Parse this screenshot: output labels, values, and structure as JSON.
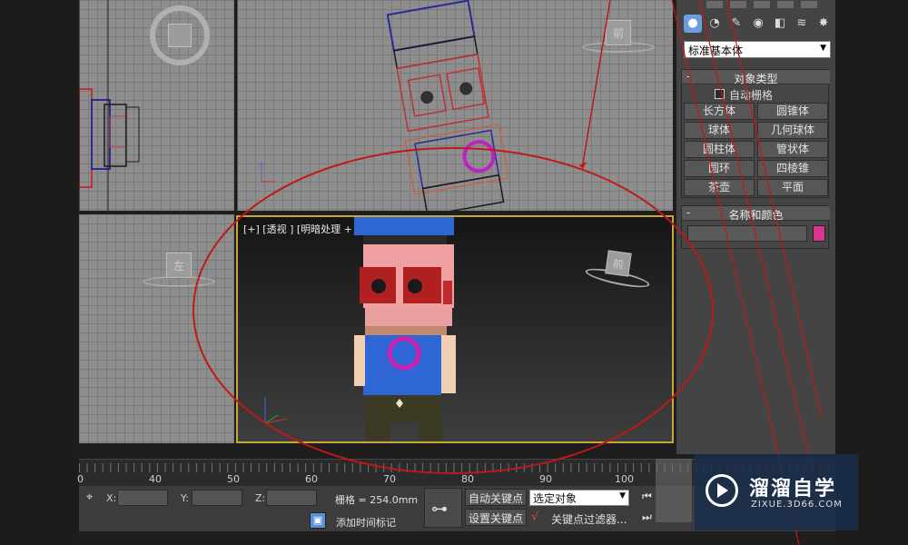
{
  "viewports": {
    "perspective_label": "[+] [透视 ] [明暗处理 + 边面 ]",
    "cube_top_right": "前",
    "cube_left": "左",
    "cube_persp": "前"
  },
  "timeline": {
    "ticks": [
      "0",
      "40",
      "50",
      "60",
      "70",
      "80",
      "90",
      "100"
    ]
  },
  "status_bar": {
    "x_label": "X:",
    "y_label": "Y:",
    "z_label": "Z:",
    "grid_text": "栅格 = 254.0mm",
    "add_time_tag": "添加时间标记",
    "auto_key": "自动关键点",
    "set_key": "设置关键点",
    "selection_value": "选定对象",
    "key_filters": "关键点过滤器..."
  },
  "command_panel": {
    "dropdown_value": "标准基本体",
    "object_type_title": "对象类型",
    "autogrid_label": "自动栅格",
    "buttons": [
      "长方体",
      "圆锥体",
      "球体",
      "几何球体",
      "圆柱体",
      "管状体",
      "圆环",
      "四棱锥",
      "茶壶",
      "平面"
    ],
    "name_color_title": "名称和颜色",
    "color": "#d6368f"
  },
  "watermark": {
    "title": "溜溜自学",
    "url": "ZIXUE.3D66.COM"
  },
  "colors": {
    "annotation": "#c01818",
    "viewport_border": "#c8a73a"
  }
}
